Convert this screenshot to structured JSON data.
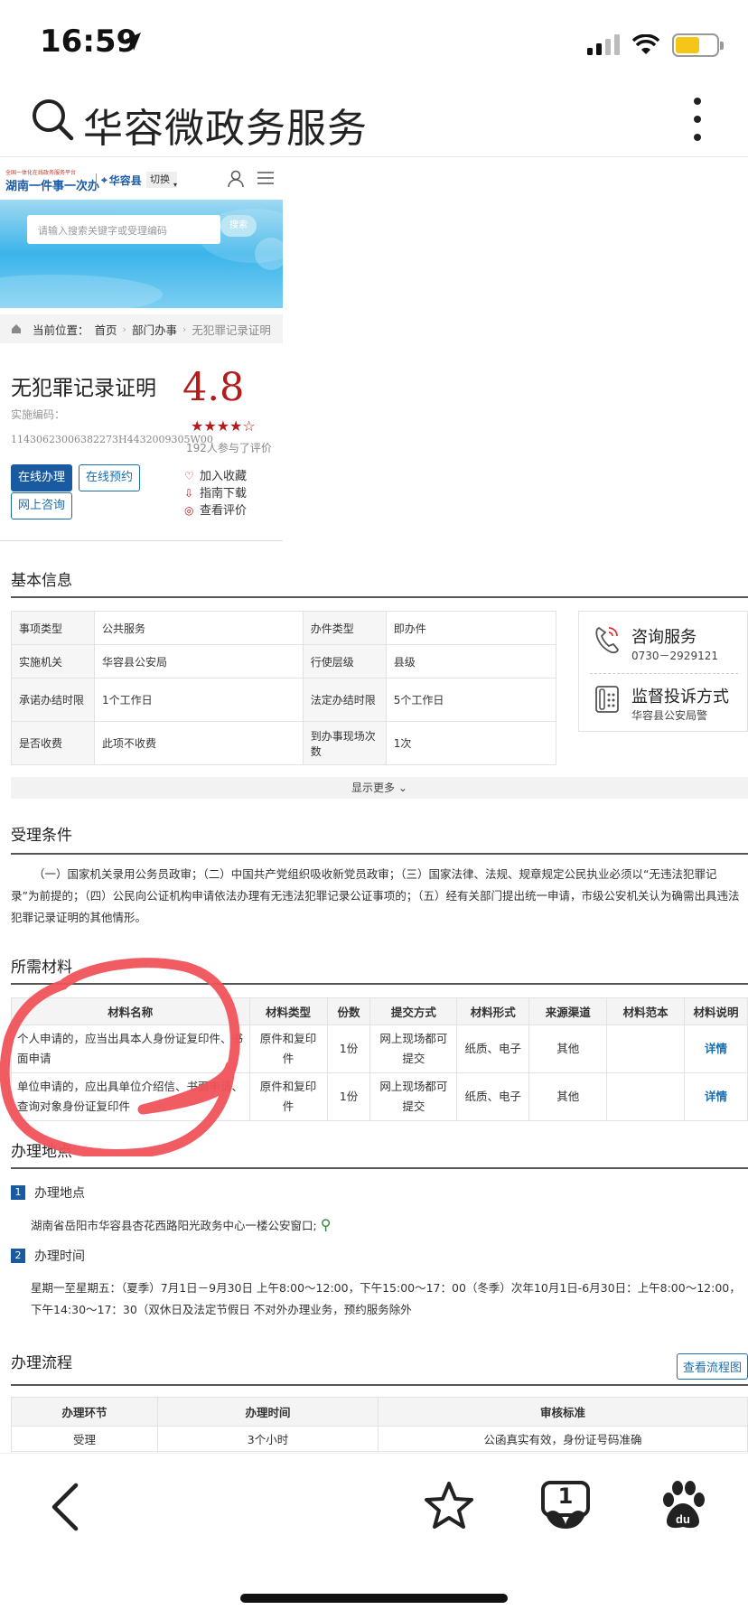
{
  "status": {
    "time": "16:59"
  },
  "browser": {
    "title": "华容微政务服务"
  },
  "site": {
    "logo_small": "全国一体化在线政务服务平台",
    "logo_big": "湖南一件事一次办",
    "location": "华容县",
    "switch": "切换",
    "search_placeholder": "请输入搜索关键字或受理编码",
    "search_button": "搜索"
  },
  "breadcrumb": {
    "label": "当前位置：",
    "home": "首页",
    "dept": "部门办事",
    "current": "无犯罪记录证明"
  },
  "item": {
    "title": "无犯罪记录证明",
    "code_label": "实施编码：",
    "code": "11430623006382273H4432009305W00",
    "score": "4.8",
    "stars": "★★★★☆",
    "rating_count": "192人参与了评价",
    "btn_online": "在线办理",
    "btn_appoint": "在线预约",
    "btn_consult": "网上咨询",
    "fav": "加入收藏",
    "guide": "指南下载",
    "review": "查看评价"
  },
  "basic": {
    "heading": "基本信息",
    "rows": [
      {
        "k1": "事项类型",
        "v1": "公共服务",
        "k2": "办件类型",
        "v2": "即办件"
      },
      {
        "k1": "实施机关",
        "v1": "华容县公安局",
        "k2": "行使层级",
        "v2": "县级"
      },
      {
        "k1": "承诺办结时限",
        "v1": "1个工作日",
        "k2": "法定办结时限",
        "v2": "5个工作日"
      },
      {
        "k1": "是否收费",
        "v1": "此项不收费",
        "k2": "到办事现场次数",
        "v2": "1次"
      }
    ],
    "consult_title": "咨询服务",
    "consult_phone": "0730－2929121",
    "supervise_title": "监督投诉方式",
    "supervise_sub": "华容县公安局警",
    "show_more": "显示更多"
  },
  "conditions": {
    "heading": "受理条件",
    "text": "（一）国家机关录用公务员政审；（二）中国共产党组织吸收新党员政审；（三）国家法律、法规、规章规定公民执业必须以“无违法犯罪记录”为前提的；（四）公民向公证机构申请依法办理有无违法犯罪记录公证事项的；（五）经有关部门提出统一申请，市级公安机关认为确需出具违法犯罪记录证明的其他情形。"
  },
  "materials": {
    "heading": "所需材料",
    "headers": [
      "材料名称",
      "材料类型",
      "份数",
      "提交方式",
      "材料形式",
      "来源渠道",
      "材料范本",
      "材料说明"
    ],
    "rows": [
      {
        "name": "个人申请的，应当出具本人身份证复印件、书面申请",
        "type": "原件和复印件",
        "count": "1份",
        "submit": "网上现场都可提交",
        "form": "纸质、电子",
        "source": "其他",
        "sample": "",
        "detail": "详情"
      },
      {
        "name": "单位申请的，应出具单位介绍信、书面申请、查询对象身份证复印件",
        "type": "原件和复印件",
        "count": "1份",
        "submit": "网上现场都可提交",
        "form": "纸质、电子",
        "source": "其他",
        "sample": "",
        "detail": "详情"
      }
    ]
  },
  "place": {
    "heading": "办理地点",
    "sub1": "办理地点",
    "address": "湖南省岳阳市华容县杏花西路阳光政务中心一楼公安窗口;",
    "sub2": "办理时间",
    "time": "星期一至星期五：（夏季）7月1日－9月30日 上午8:00～12:00，下午15:00～17：00（冬季）次年10月1日-6月30日：上午8:00～12:00，下午14:30～17：30（双休日及法定节假日 不对外办理业务，预约服务除外"
  },
  "process": {
    "heading": "办理流程",
    "flow_button": "查看流程图",
    "headers": [
      "办理环节",
      "办理时间",
      "审核标准"
    ],
    "rows": [
      {
        "step": "受理",
        "time": "3个小时",
        "standard": "公函真实有效，身份证号码准确"
      }
    ]
  },
  "bottom": {
    "tab_count": "1"
  },
  "colors": {
    "brand": "#1a5aa0",
    "score": "#b31c1c",
    "annotation": "#f0525a"
  }
}
